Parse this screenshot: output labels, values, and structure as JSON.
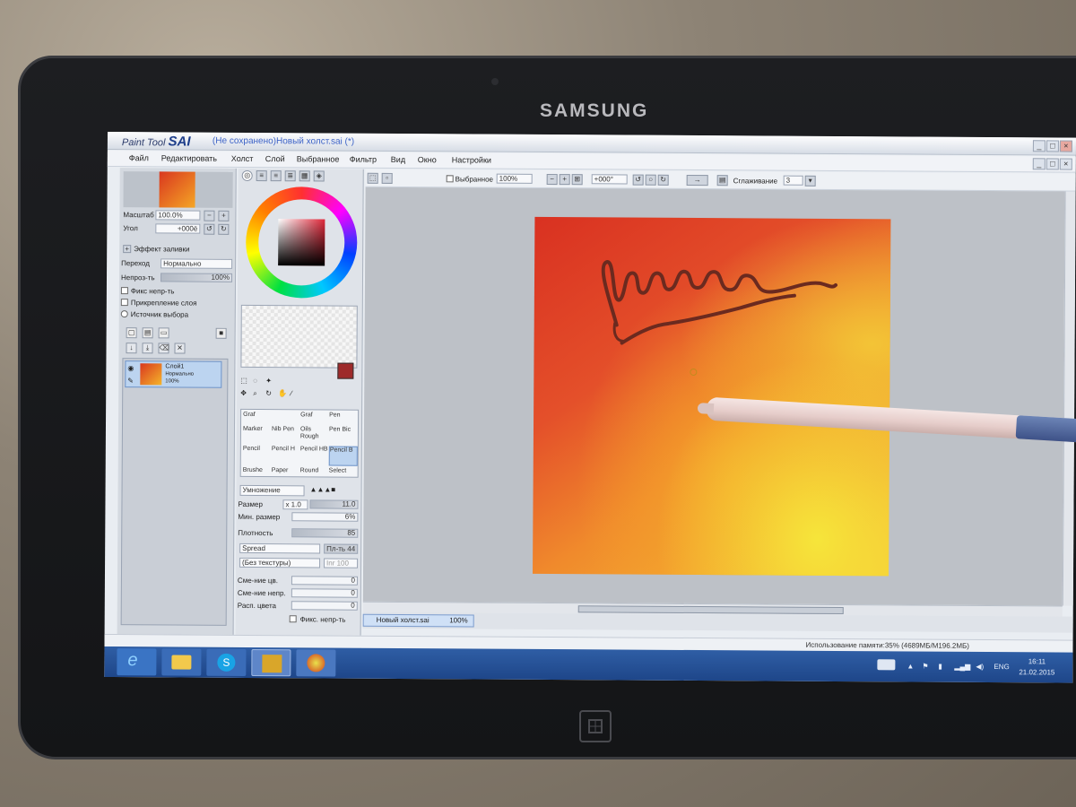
{
  "device": {
    "brand": "SAMSUNG"
  },
  "app": {
    "logo_small": "Paint Tool",
    "logo_big": "SAI",
    "window_title": "(Не сохранено)Новый холст.sai (*)"
  },
  "menu": [
    "Файл",
    "Редактировать",
    "Холст",
    "Слой",
    "Выбранное",
    "Фильтр",
    "Вид",
    "Окно",
    "Настройки"
  ],
  "navigator": {
    "zoom_label": "Масштаб",
    "zoom_value": "100.0%",
    "angle_label": "Угол",
    "angle_value": "+000ё",
    "effect_label": "Эффект заливки",
    "blend_label": "Переход",
    "blend_value": "Нормально",
    "opacity_label": "Непроз-ть",
    "opacity_value": "100%",
    "opacity_fraction": 1.0,
    "check1": "Фикс непр-ть",
    "check2": "Прикрепление слоя",
    "check3": "Источник выбора"
  },
  "layer": {
    "name": "Слой1",
    "mode": "Нормально",
    "opacity": "100%"
  },
  "tools": {
    "brushes": [
      {
        "label": "Graf"
      },
      {
        "label": "Graf"
      },
      {
        "label": "Pen"
      },
      {
        "label": "Marker"
      },
      {
        "label": "Nib Pen"
      },
      {
        "label": "Oils Rough"
      },
      {
        "label": "Pen Bic"
      },
      {
        "label": "Pencil"
      },
      {
        "label": "Pencil H"
      },
      {
        "label": "Pencil HB"
      },
      {
        "label": "Pencil B"
      },
      {
        "label": "Brushe"
      },
      {
        "label": "Paper"
      },
      {
        "label": "Round"
      },
      {
        "label": "Select"
      }
    ],
    "blend_mode": "Умножение",
    "size_label": "Размер",
    "size_mult": "x 1.0",
    "size_value": "11.0",
    "min_size_label": "Мин. размер",
    "min_size_value": "6%",
    "density_label": "Плотность",
    "density_value": "85",
    "spread_value": "Spread",
    "spread_extra": "Пл-ть 44",
    "texture_value": "(Без текстуры)",
    "texture_extra": "Inr 100",
    "mix_label": "Сме-ние цв.",
    "mix_value": "0",
    "mix_opacity_label": "Сме-ние непр.",
    "mix_opacity_value": "0",
    "color_spread_label": "Расп. цвета",
    "color_spread_value": "0",
    "fix_opacity_label": "Фикс. непр-ть",
    "main_color": "#9e2a2a"
  },
  "canvas_toolbar": {
    "selection_label": "Выбранное",
    "zoom": "100%",
    "angle": "+000°",
    "smoothing_label": "Сглаживание",
    "smoothing_value": "3"
  },
  "tab": {
    "name": "Новый холст.sai",
    "zoom": "100%"
  },
  "status": {
    "memory": "Использование памяти:35% (4689МБ/М196.2МБ)"
  },
  "taskbar": {
    "lang": "ENG",
    "time": "16:11",
    "date": "21.02.2015"
  }
}
